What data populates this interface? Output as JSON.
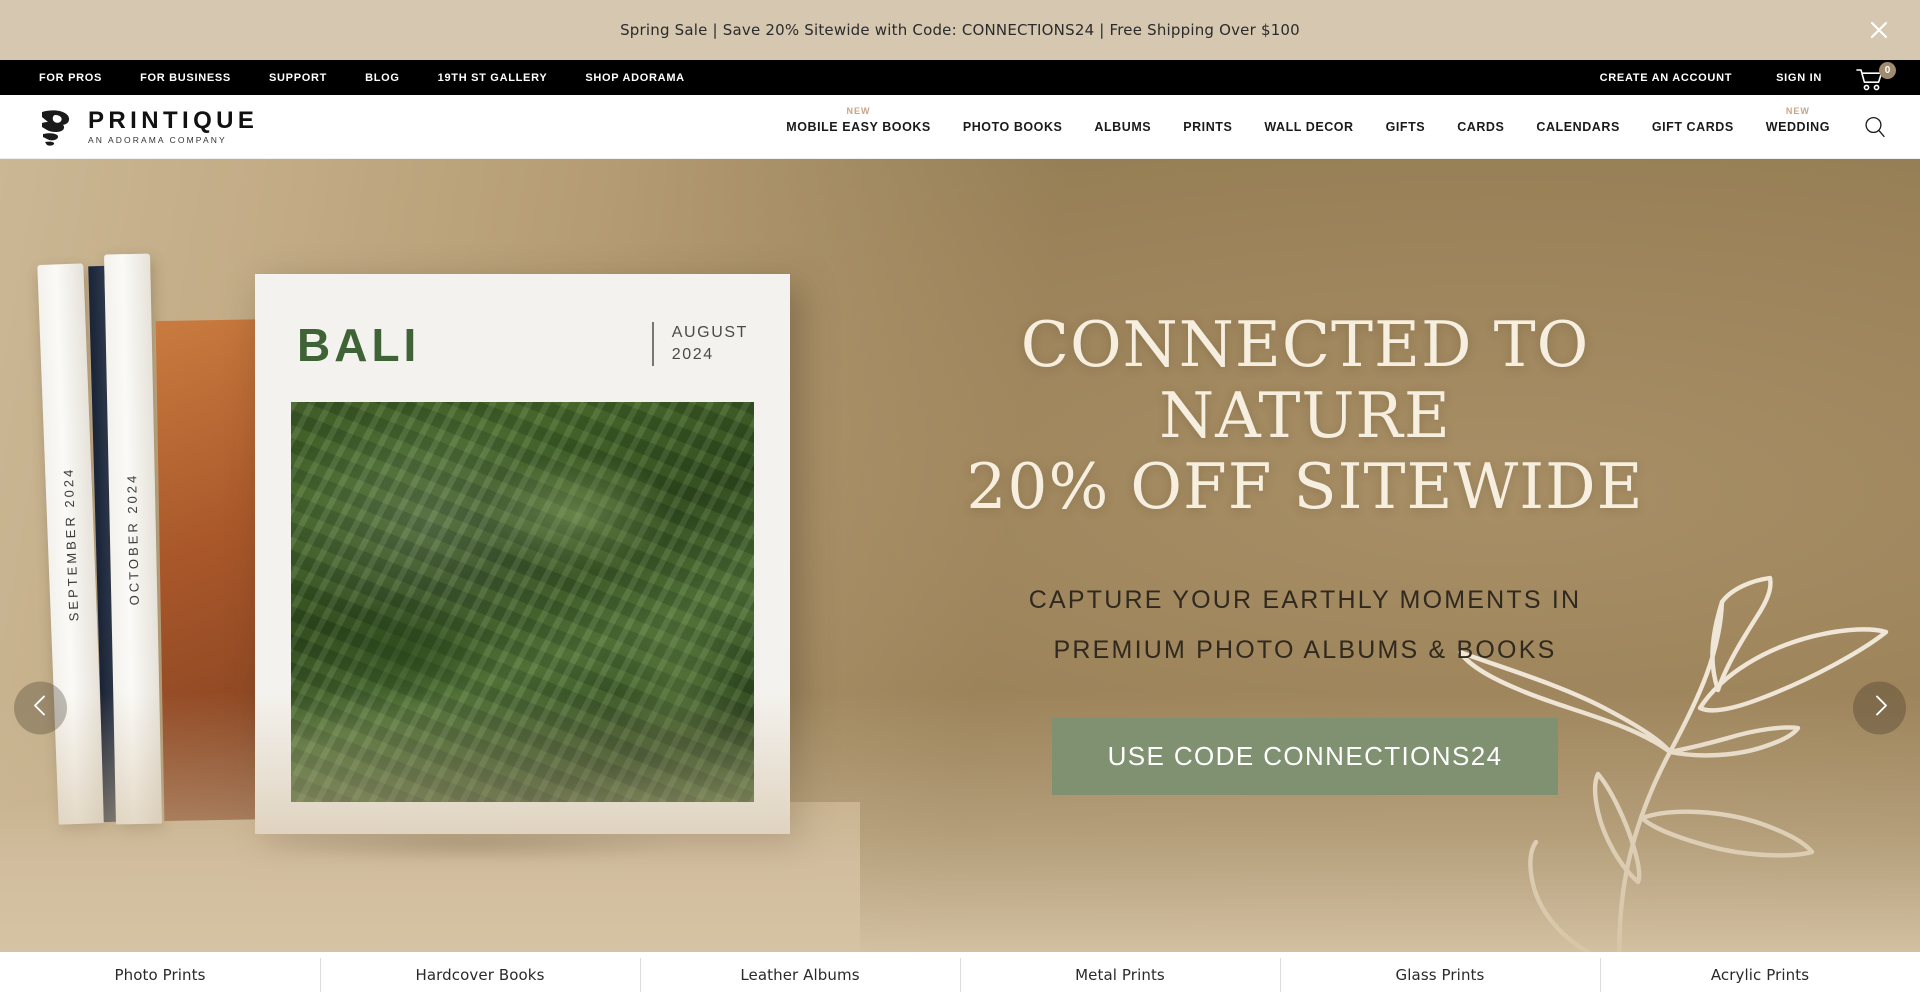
{
  "promo": {
    "text": "Spring Sale | Save 20% Sitewide with Code: CONNECTIONS24 | Free Shipping Over $100",
    "close_icon": "close-icon",
    "background": "#d6c8b0"
  },
  "utility_nav": {
    "left_links": [
      {
        "label": "FOR PROS"
      },
      {
        "label": "FOR BUSINESS"
      },
      {
        "label": "SUPPORT"
      },
      {
        "label": "BLOG"
      },
      {
        "label": "19TH ST GALLERY"
      },
      {
        "label": "SHOP ADORAMA"
      }
    ],
    "right_links": [
      {
        "label": "CREATE AN ACCOUNT"
      },
      {
        "label": "SIGN IN"
      }
    ],
    "cart": {
      "icon": "shopping-cart-icon",
      "count": "0",
      "badge_color": "#a08b6e"
    }
  },
  "brand": {
    "mark": "printique-logo-mark",
    "name": "PRINTIQUE",
    "tagline": "AN ADORAMA COMPANY"
  },
  "main_nav": {
    "items": [
      {
        "label": "MOBILE EASY BOOKS",
        "badge": "NEW"
      },
      {
        "label": "PHOTO BOOKS",
        "badge": ""
      },
      {
        "label": "ALBUMS",
        "badge": ""
      },
      {
        "label": "PRINTS",
        "badge": ""
      },
      {
        "label": "WALL DECOR",
        "badge": ""
      },
      {
        "label": "GIFTS",
        "badge": ""
      },
      {
        "label": "CARDS",
        "badge": ""
      },
      {
        "label": "CALENDARS",
        "badge": ""
      },
      {
        "label": "GIFT CARDS",
        "badge": ""
      },
      {
        "label": "WEDDING",
        "badge": "NEW"
      }
    ],
    "badge_color": "#c9a489",
    "search_icon": "search-icon"
  },
  "hero": {
    "headline_line1": "CONNECTED TO NATURE",
    "headline_line2": "20% OFF SITEWIDE",
    "sub_line1": "CAPTURE YOUR EARTHLY MOMENTS IN",
    "sub_line2": "PREMIUM PHOTO ALBUMS & BOOKS",
    "cta_label": "USE CODE CONNECTIONS24",
    "cta_color": "#7f9170",
    "headline_color": "#f6eede",
    "prev_icon": "chevron-left-icon",
    "next_icon": "chevron-right-icon",
    "product": {
      "cover_title": "BALI",
      "cover_month": "AUGUST",
      "cover_year": "2024",
      "cover_title_color": "#3f6237",
      "spine_1_label": "SEPTEMBER 2024",
      "spine_2_label": "OCTOBER 2024"
    },
    "decor_icon": "leaf-line-art-icon"
  },
  "categories": {
    "items": [
      {
        "label": "Photo Prints"
      },
      {
        "label": "Hardcover Books"
      },
      {
        "label": "Leather Albums"
      },
      {
        "label": "Metal Prints"
      },
      {
        "label": "Glass Prints"
      },
      {
        "label": "Acrylic Prints"
      }
    ]
  }
}
